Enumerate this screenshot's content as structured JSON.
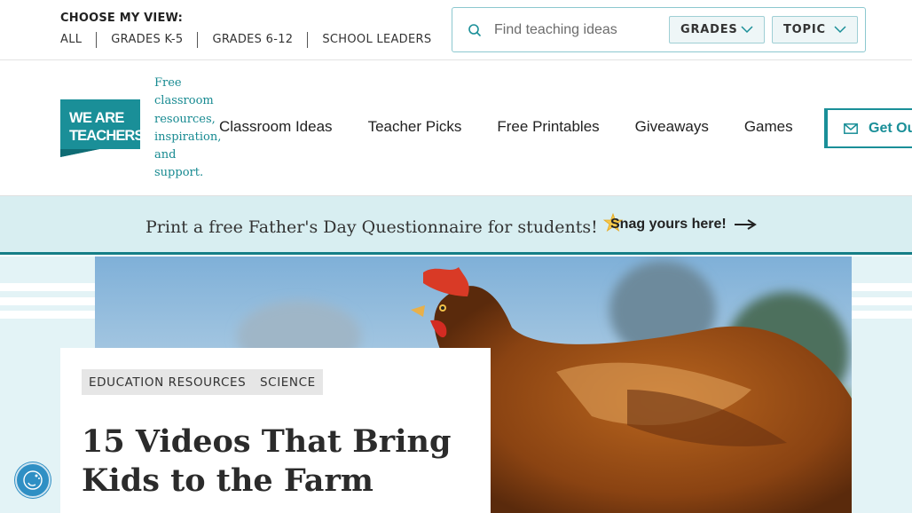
{
  "topbar": {
    "view_label": "CHOOSE MY VIEW:",
    "view_links": [
      "ALL",
      "GRADES K-5",
      "GRADES 6-12",
      "SCHOOL LEADERS"
    ],
    "search_placeholder": "Find teaching ideas",
    "filters": [
      "GRADES",
      "TOPIC"
    ]
  },
  "header": {
    "logo_text": [
      "WE ARE",
      "TEACHERS"
    ],
    "tagline": "Free classroom resources, inspiration, and support.",
    "nav": [
      "Classroom Ideas",
      "Teacher Picks",
      "Free Printables",
      "Giveaways",
      "Games"
    ],
    "cta_label": "Get Ou"
  },
  "promo": {
    "text": "Print a free Father's Day Questionnaire for students!",
    "link_label": "Snag yours here!"
  },
  "article": {
    "tags": [
      "EDUCATION RESOURCES",
      "SCIENCE"
    ],
    "title": "15 Videos That Bring Kids to the Farm"
  },
  "colors": {
    "brand_teal": "#1a8f98",
    "banner_bg": "#d8eef1",
    "accessibility_blue": "#2f8fc4"
  }
}
